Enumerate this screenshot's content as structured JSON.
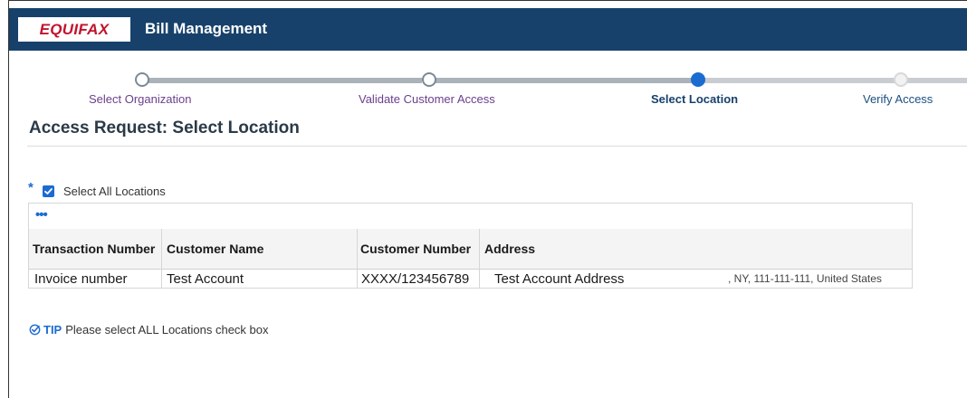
{
  "header": {
    "logo_text": "EQUIFAX",
    "title": "Bill Management",
    "bg_color": "#17416b",
    "logo_color": "#c0132d"
  },
  "train": {
    "steps": [
      {
        "label": "Select Organization",
        "state": "visited"
      },
      {
        "label": "Validate Customer Access",
        "state": "visited"
      },
      {
        "label": "Select Location",
        "state": "current"
      },
      {
        "label": "Verify Access",
        "state": "future"
      }
    ]
  },
  "page": {
    "title": "Access Request: Select Location"
  },
  "select_all": {
    "required_marker": "*",
    "label": "Select All Locations",
    "checked": true
  },
  "table": {
    "toolbar_icon": "more-options-icon",
    "toolbar_glyph": "•••",
    "columns": [
      "Transaction Number",
      "Customer Name",
      "Customer Number",
      "Address"
    ],
    "rows": [
      {
        "transaction_number": "Invoice number",
        "customer_name": "Test Account",
        "customer_number": "XXXX/123456789",
        "address_line": "Test Account Address",
        "address_tail": ", NY, 111-111-111, United States"
      }
    ]
  },
  "tip": {
    "icon": "check-badge-icon",
    "label": "TIP",
    "text": "Please select ALL Locations check box"
  },
  "colors": {
    "accent": "#1c6bd0",
    "visited_step": "#6a3f8c"
  }
}
